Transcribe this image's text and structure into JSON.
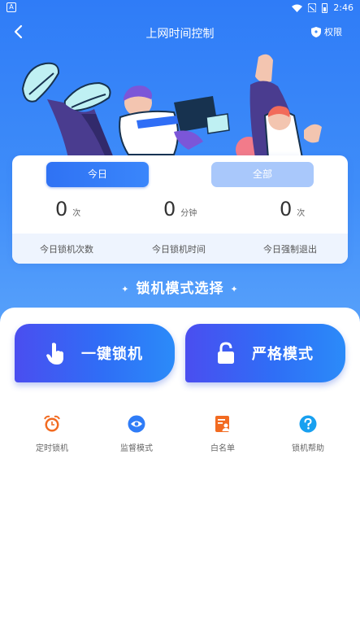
{
  "status_bar": {
    "time": "2:46",
    "left_icon": "A"
  },
  "nav": {
    "title": "上网时间控制",
    "permission_label": "权限"
  },
  "stats": {
    "tabs": [
      {
        "label": "今日",
        "selected": true
      },
      {
        "label": "全部",
        "selected": false
      }
    ],
    "items": [
      {
        "value": "0",
        "unit": "次",
        "label": "今日锁机次数"
      },
      {
        "value": "0",
        "unit": "分钟",
        "label": "今日锁机时间"
      },
      {
        "value": "0",
        "unit": "次",
        "label": "今日强制退出"
      }
    ]
  },
  "section": {
    "title": "锁机模式选择",
    "sparkle": "✦"
  },
  "modes": [
    {
      "label": "一键锁机",
      "icon": "hand-pointer-icon"
    },
    {
      "label": "严格模式",
      "icon": "padlock-icon"
    }
  ],
  "features": [
    {
      "label": "定时锁机",
      "icon": "alarm-clock-icon",
      "color": "#f26b21"
    },
    {
      "label": "监督模式",
      "icon": "eye-icon",
      "color": "#2f7cf7"
    },
    {
      "label": "白名单",
      "icon": "document-person-icon",
      "color": "#f26b21"
    },
    {
      "label": "锁机帮助",
      "icon": "question-icon",
      "color": "#18a0f0"
    }
  ],
  "colors": {
    "primary": "#2f7cf7",
    "tab_inactive": "#a9c8fb",
    "orange": "#f26b21"
  }
}
